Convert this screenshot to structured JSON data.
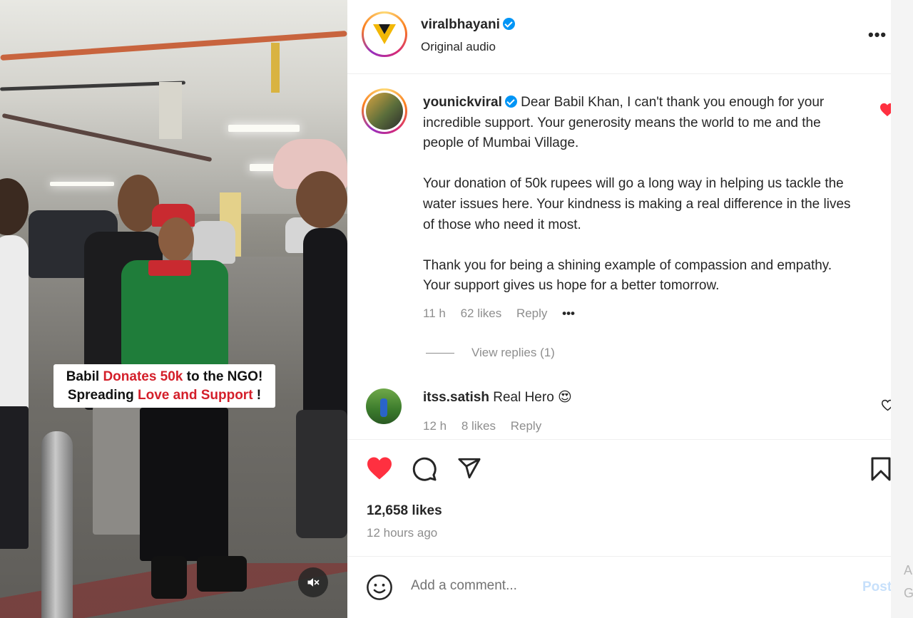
{
  "video": {
    "caption_line1_prefix": "Babil ",
    "caption_line1_highlight": "Donates 50k",
    "caption_line1_suffix": " to the NGO!",
    "caption_line2_prefix": "Spreading ",
    "caption_line2_highlight": "Love and Support",
    "caption_line2_suffix": " !",
    "mute_icon": "speaker-muted-icon"
  },
  "post": {
    "author": "viralbhayani",
    "verified": true,
    "audio": "Original audio",
    "more_icon": "more-horizontal-icon"
  },
  "comments": [
    {
      "user": "younickviral",
      "verified": true,
      "paragraphs": [
        "Dear Babil Khan, I can't thank you enough for your incredible support. Your generosity means the world to me and the people of Mumbai Village.",
        "Your donation of 50k rupees will go a long way in helping us tackle the water issues here. Your kindness is making a real difference in the lives of those who need it most.",
        "Thank you for being a shining example of compassion and empathy. Your support gives us hope for a better tomorrow."
      ],
      "time": "11 h",
      "likes": "62 likes",
      "reply_label": "Reply",
      "more": "•••",
      "liked": true,
      "view_replies": "View replies (1)"
    },
    {
      "user": "itss.satish",
      "text": "Real Hero",
      "emoji": "😍",
      "time": "12 h",
      "likes": "8 likes",
      "reply_label": "Reply",
      "liked": false
    }
  ],
  "actions": {
    "liked": true,
    "like_count": "12,658 likes",
    "posted_ago": "12 hours ago"
  },
  "composer": {
    "placeholder": "Add a comment...",
    "post_label": "Post"
  },
  "colors": {
    "like_red": "#ff3040",
    "verified_blue": "#0095f6",
    "caption_red": "#d41f2a"
  }
}
